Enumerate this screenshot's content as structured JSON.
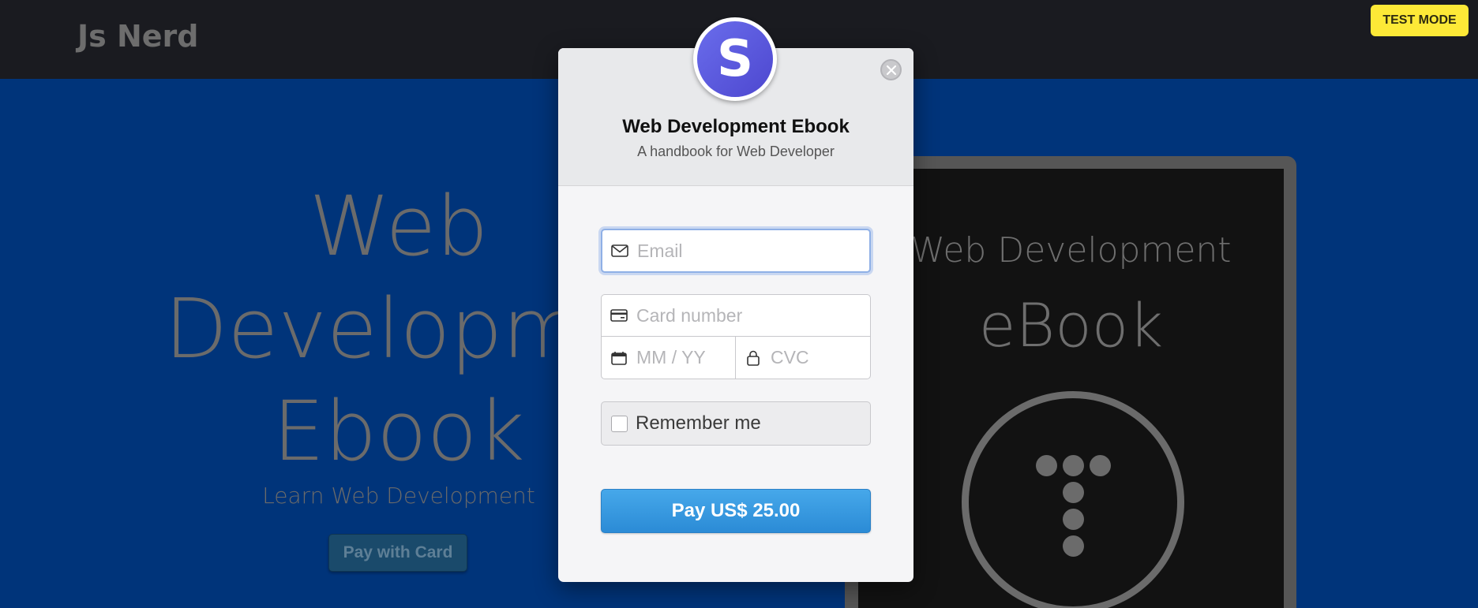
{
  "header": {
    "brand": "Js Nerd",
    "test_mode_badge": "TEST MODE"
  },
  "hero": {
    "title_lines": [
      "Web",
      "Developme",
      "Ebook"
    ],
    "subtitle": "Learn Web Development",
    "pay_button": "Pay with Card"
  },
  "device": {
    "line1": "Web Development",
    "line2": "eBook",
    "logo_icon": "dotted-t-logo"
  },
  "modal": {
    "avatar_letter": "S",
    "close_icon": "close-icon",
    "title": "Web Development Ebook",
    "subtitle": "A handbook for Web Developer",
    "email": {
      "placeholder": "Email",
      "value": "",
      "icon": "mail-icon"
    },
    "card_number": {
      "placeholder": "Card number",
      "value": "",
      "icon": "credit-card-icon"
    },
    "expiry": {
      "placeholder": "MM / YY",
      "value": "",
      "icon": "calendar-icon"
    },
    "cvc": {
      "placeholder": "CVC",
      "value": "",
      "icon": "lock-icon"
    },
    "remember_me": {
      "label": "Remember me",
      "checked": false
    },
    "pay_button": "Pay US$ 25.00"
  },
  "colors": {
    "hero_bg": "#00347a",
    "topbar_bg": "#1a1b20",
    "pay_button": "#2b8bd6",
    "test_mode": "#fde937",
    "avatar": "#5a57de"
  }
}
